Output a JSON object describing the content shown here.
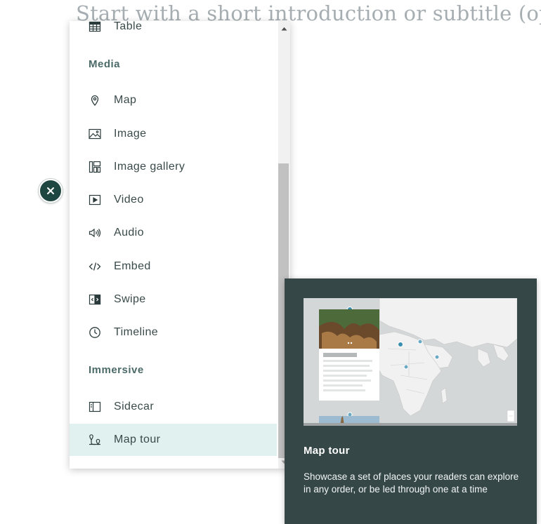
{
  "story": {
    "subtitle_placeholder": "Start with a short introduction or subtitle (op"
  },
  "close_button": {
    "icon": "close-icon"
  },
  "block_menu": {
    "partial_item": {
      "label": "Table",
      "icon": "table-icon"
    },
    "sections": [
      {
        "heading": "Media",
        "items": [
          {
            "label": "Map",
            "icon": "map-pin-icon"
          },
          {
            "label": "Image",
            "icon": "image-icon"
          },
          {
            "label": "Image gallery",
            "icon": "image-gallery-icon"
          },
          {
            "label": "Video",
            "icon": "video-icon"
          },
          {
            "label": "Audio",
            "icon": "audio-icon"
          },
          {
            "label": "Embed",
            "icon": "embed-icon"
          },
          {
            "label": "Swipe",
            "icon": "swipe-icon"
          },
          {
            "label": "Timeline",
            "icon": "timeline-icon"
          }
        ]
      },
      {
        "heading": "Immersive",
        "items": [
          {
            "label": "Sidecar",
            "icon": "sidecar-icon"
          },
          {
            "label": "Map tour",
            "icon": "map-tour-icon",
            "selected": true
          }
        ]
      }
    ]
  },
  "tooltip": {
    "title": "Map tour",
    "description": "Showcase a set of places your readers can explore in any order, or be led through one at a time",
    "preview_image": "map-tour-preview"
  },
  "colors": {
    "accent_dark": "#1f4741",
    "section_heading": "#4b6a68",
    "selected_row": "#e1f1ef",
    "tooltip_bg": "#354747"
  }
}
